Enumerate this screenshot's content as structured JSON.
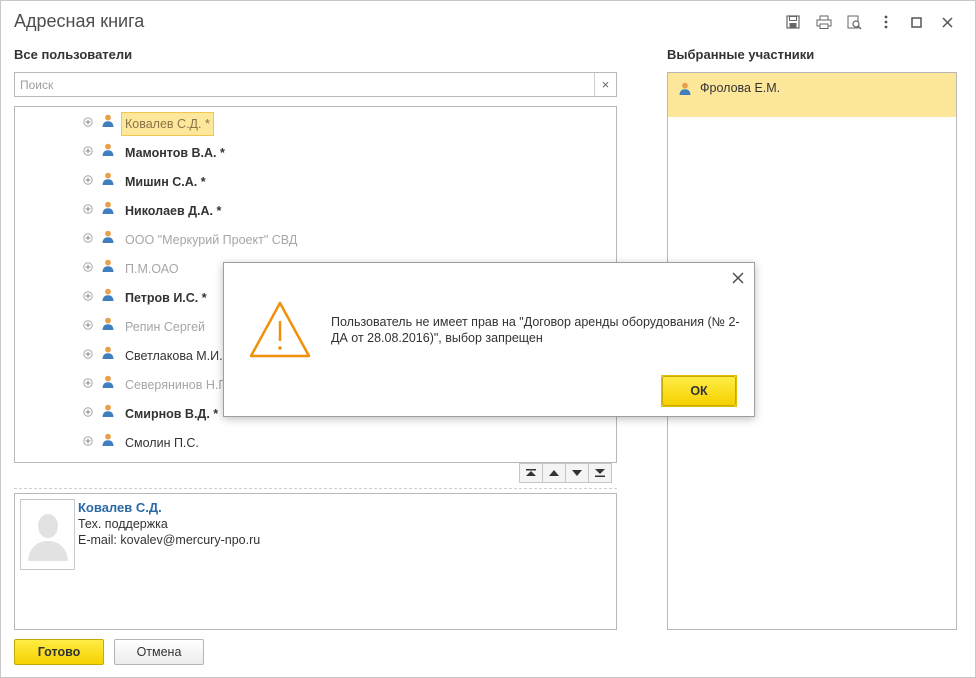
{
  "window": {
    "title": "Адресная книга",
    "toolbar_icons": [
      "save-icon",
      "print-icon",
      "preview-icon",
      "more-icon",
      "maximize-icon",
      "close-icon"
    ]
  },
  "left": {
    "title": "Все пользователи",
    "search": {
      "placeholder": "Поиск",
      "value": "",
      "clear_label": "×"
    },
    "users": [
      {
        "name": "Ковалев С.Д. *",
        "style": "selected"
      },
      {
        "name": "Мамонтов В.А. *",
        "style": "bold"
      },
      {
        "name": "Мишин С.А. *",
        "style": "bold"
      },
      {
        "name": "Николаев Д.А. *",
        "style": "bold"
      },
      {
        "name": "ООО \"Меркурий Проект\" СВД",
        "style": "dim"
      },
      {
        "name": "П.М.ОАО",
        "style": "dim"
      },
      {
        "name": "Петров И.С. *",
        "style": "bold"
      },
      {
        "name": "Репин Сергей",
        "style": "dim"
      },
      {
        "name": "Светлакова М.И.",
        "style": "normal"
      },
      {
        "name": "Северянинов Н.П.",
        "style": "dim"
      },
      {
        "name": "Смирнов В.Д. *",
        "style": "bold"
      },
      {
        "name": "Смолин П.С.",
        "style": "normal"
      }
    ],
    "nav_icons": [
      "move-first-icon",
      "move-up-icon",
      "move-down-icon",
      "move-last-icon"
    ]
  },
  "details": {
    "name": "Ковалев С.Д.",
    "position": "Тех. поддержка",
    "email": "E-mail: kovalev@mercury-npo.ru"
  },
  "right": {
    "title": "Выбранные участники",
    "items": [
      {
        "name": "Фролова Е.М."
      }
    ]
  },
  "buttons": {
    "done": "Готово",
    "cancel": "Отмена"
  },
  "dialog": {
    "message": "Пользователь не имеет прав на \"Договор аренды оборудования (№ 2-ДА от 28.08.2016)\", выбор запрещен",
    "ok": "ОК"
  },
  "colors": {
    "accent_yellow": "#f5d100",
    "selection": "#fde79b",
    "warning": "#f0900b",
    "link": "#2a6aa6"
  }
}
